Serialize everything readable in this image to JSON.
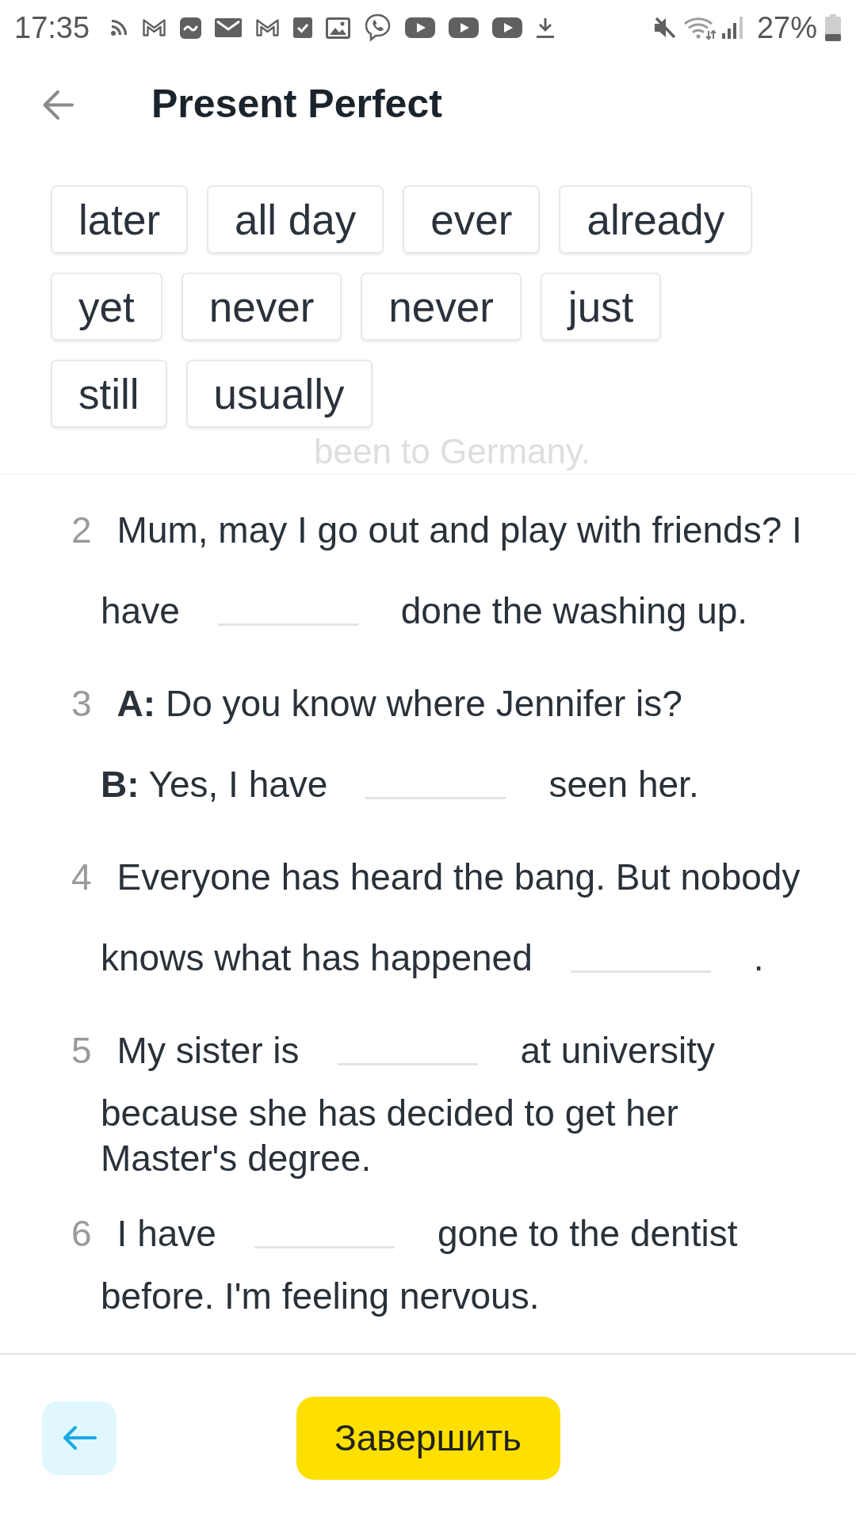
{
  "status_bar": {
    "time": "17:35",
    "battery": "27%"
  },
  "header": {
    "title": "Present Perfect"
  },
  "word_bank": [
    "later",
    "all day",
    "ever",
    "already",
    "yet",
    "never",
    "never",
    "just",
    "still",
    "usually"
  ],
  "scrolled_text": "been to Germany.",
  "exercises": [
    {
      "number": "2",
      "lines": [
        [
          {
            "kind": "text",
            "text": "Mum, may I go out and play with friends? I"
          }
        ],
        [
          {
            "kind": "text",
            "text": "have"
          },
          {
            "kind": "blank"
          },
          {
            "kind": "text",
            "text": "done the washing up."
          }
        ]
      ]
    },
    {
      "number": "3",
      "lines": [
        [
          {
            "kind": "text",
            "text": "**A:** Do you know where Jennifer is?"
          }
        ],
        [
          {
            "kind": "text",
            "text": "**B:** Yes, I have"
          },
          {
            "kind": "blank"
          },
          {
            "kind": "text",
            "text": "seen her."
          }
        ]
      ]
    },
    {
      "number": "4",
      "lines": [
        [
          {
            "kind": "text",
            "text": "Everyone has heard the bang. But nobody"
          }
        ],
        [
          {
            "kind": "text",
            "text": "knows what has happened"
          },
          {
            "kind": "blank"
          },
          {
            "kind": "text",
            "text": "."
          }
        ]
      ]
    },
    {
      "number": "5",
      "lines": [
        [
          {
            "kind": "text",
            "text": "My sister is"
          },
          {
            "kind": "blank"
          },
          {
            "kind": "text",
            "text": "at university"
          }
        ],
        [
          {
            "kind": "text",
            "text": "because she has decided to get her"
          }
        ],
        [
          {
            "kind": "text",
            "text": "Master's degree."
          }
        ]
      ]
    },
    {
      "number": "6",
      "lines": [
        [
          {
            "kind": "text",
            "text": "I have"
          },
          {
            "kind": "blank"
          },
          {
            "kind": "text",
            "text": "gone to the dentist"
          }
        ],
        [
          {
            "kind": "text",
            "text": "before. I'm feeling nervous."
          }
        ]
      ]
    }
  ],
  "footer": {
    "finish_button": "Завершить"
  }
}
